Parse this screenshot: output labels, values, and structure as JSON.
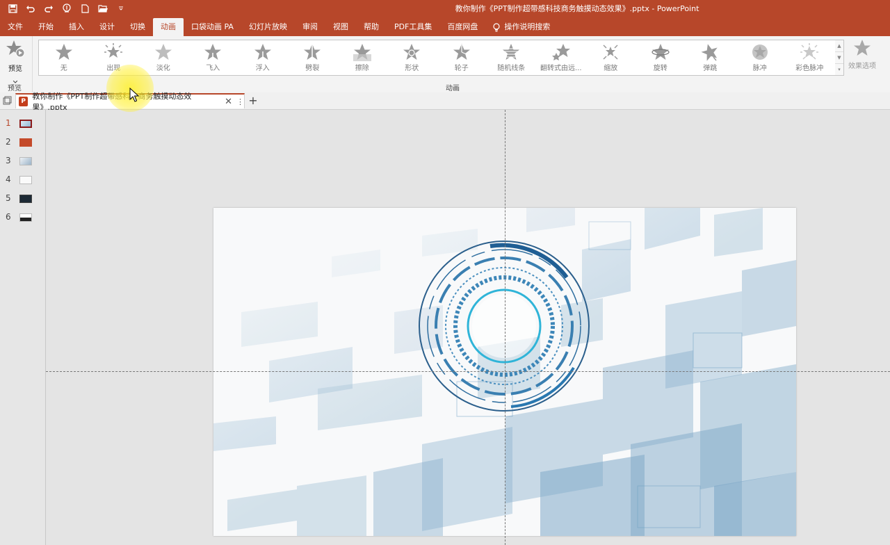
{
  "title_bar": {
    "document_title": "教你制作《PPT制作超带感科技商务触摸动态效果》.pptx  -  PowerPoint",
    "qat_icons": [
      "save-icon",
      "undo-icon",
      "redo-icon",
      "touch-mode-icon",
      "new-file-icon",
      "open-folder-icon",
      "customize-qat-icon"
    ]
  },
  "tabs": [
    "文件",
    "开始",
    "插入",
    "设计",
    "切换",
    "动画",
    "口袋动画 PA",
    "幻灯片放映",
    "审阅",
    "视图",
    "帮助",
    "PDF工具集",
    "百度网盘"
  ],
  "active_tab": "动画",
  "search_label": "操作说明搜索",
  "ribbon": {
    "preview_label": "预览",
    "preview_group_label": "预览",
    "animation_group_label": "动画",
    "animations": [
      "无",
      "出现",
      "淡化",
      "飞入",
      "浮入",
      "劈裂",
      "擦除",
      "形状",
      "轮子",
      "随机线条",
      "翻转式由远...",
      "缩放",
      "旋转",
      "弹跳",
      "脉冲",
      "彩色脉冲"
    ],
    "effect_options_label": "效果选项"
  },
  "document_tab": {
    "label": "教你制作《PPT制作超带感科技商务触摸动态效果》.pptx",
    "badge": "P"
  },
  "slides": [
    {
      "number": "1",
      "active": true
    },
    {
      "number": "2",
      "active": false
    },
    {
      "number": "3",
      "active": false
    },
    {
      "number": "4",
      "active": false
    },
    {
      "number": "5",
      "active": false
    },
    {
      "number": "6",
      "active": false
    }
  ],
  "colors": {
    "accent": "#b7472a",
    "ribbon_bg": "#f3f3f3",
    "slide_blue": "#5b93bd"
  }
}
